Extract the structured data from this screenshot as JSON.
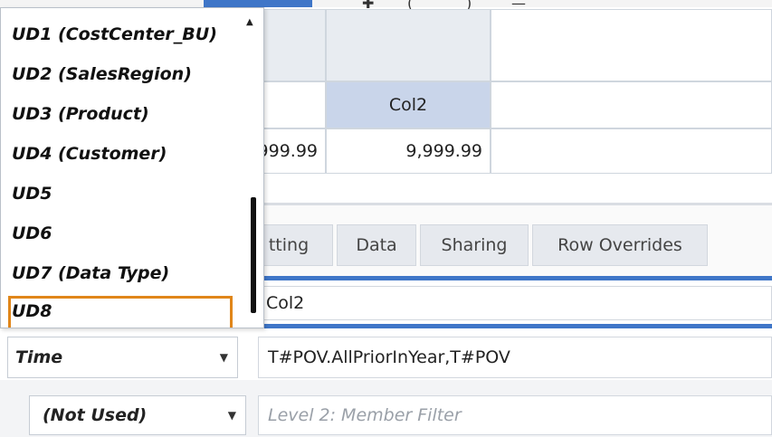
{
  "grid": {
    "col2_header": "Col2",
    "value_left": "999.99",
    "value_right": "9,999.99"
  },
  "tabs": [
    {
      "label": "tting"
    },
    {
      "label": "Data"
    },
    {
      "label": "Sharing"
    },
    {
      "label": "Row Overrides"
    }
  ],
  "name_field": {
    "value": "Col2"
  },
  "row1": {
    "dimension": "Time",
    "member_filter": "T#POV.AllPriorInYear,T#POV"
  },
  "row2": {
    "dimension": "(Not Used)",
    "member_filter_placeholder": "Level 2: Member Filter"
  },
  "dimension_list": {
    "items": [
      "UD1 (CostCenter_BU)",
      "UD2 (SalesRegion)",
      "UD3 (Product)",
      "UD4 (Customer)",
      "UD5",
      "UD6",
      "UD7 (Data Type)",
      "UD8"
    ],
    "highlighted": "UD8"
  },
  "colors": {
    "accent": "#3f76c8",
    "highlight_border": "#e0861a",
    "header_selected": "#c9d5ea"
  }
}
